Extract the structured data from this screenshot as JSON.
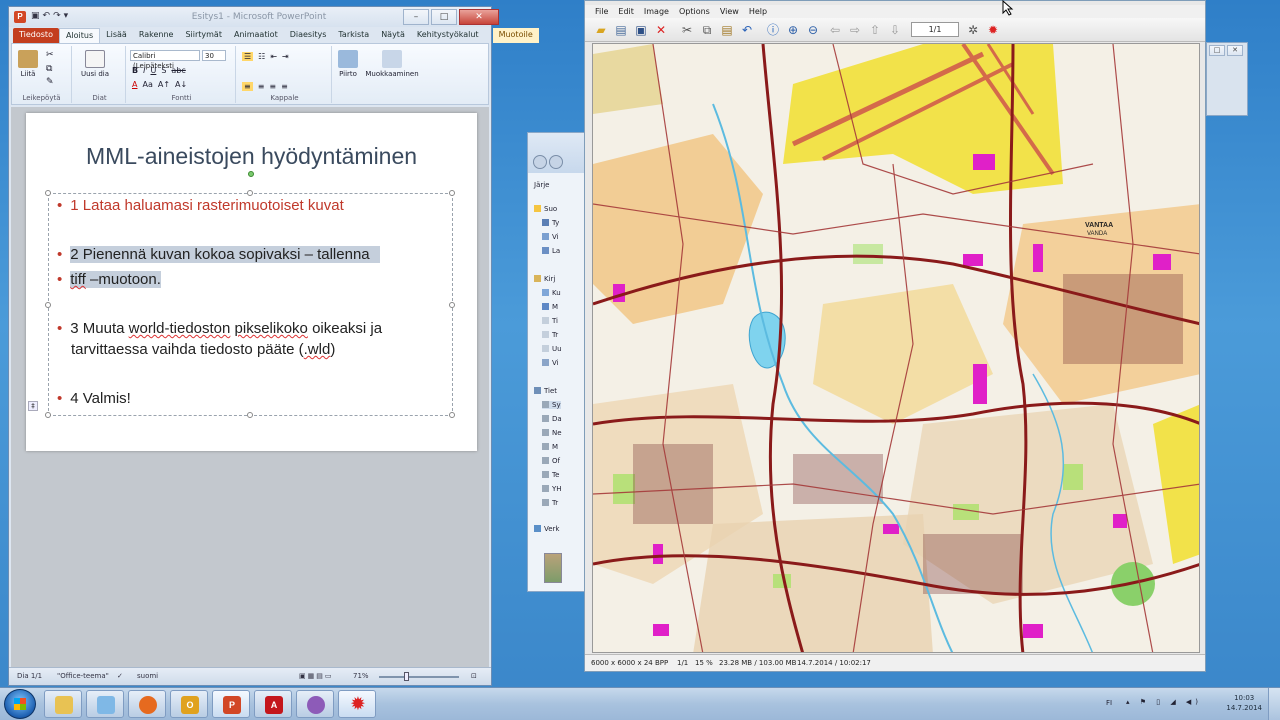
{
  "powerpoint": {
    "window_title": "Esitys1 - Microsoft PowerPoint",
    "app_icon": "P",
    "tabs": [
      "Tiedosto",
      "Aloitus",
      "Lisää",
      "Rakenne",
      "Siirtymät",
      "Animaatiot",
      "Diaesitys",
      "Tarkista",
      "Näytä",
      "Kehitystyökalut",
      "Muotoile"
    ],
    "ribbon": {
      "paste_label": "Liitä",
      "new_slide_label": "Uusi dia",
      "font_name": "Calibri (Leipäteksti",
      "font_size": "30",
      "draw_label": "Piirto",
      "editing_label": "Muokkaaminen",
      "groups": [
        "Leikepöytä",
        "Diat",
        "Fontti",
        "Kappale"
      ]
    },
    "slide": {
      "title": "MML-aineistojen hyödyntäminen",
      "bullets": {
        "b1": "1 Lataa haluamasi rasterimuotoiset  kuvat",
        "b2": "2 Pienennä kuvan kokoa sopivaksi – tallenna",
        "b3a": "tiff",
        "b3b": " –muotoon.",
        "b4a": "3 Muuta ",
        "b4b": "world-tiedoston",
        "b4c": " ",
        "b4d": "pikselikoko",
        "b4e": " oikeaksi ja",
        "b5a": "tarvittaessa vaihda tiedosto pääte (",
        "b5b": ".wld",
        "b5c": ")",
        "b6": "4 Valmis!"
      }
    },
    "status": {
      "slide": "Dia 1/1",
      "theme": "\"Office-teema\"",
      "language": "suomi",
      "zoom": "71%"
    }
  },
  "explorer": {
    "toolbar_label": "Järje",
    "items": [
      "Suo",
      "Ty",
      "Vi",
      "La",
      "Kirj",
      "Ku",
      "M",
      "Ti",
      "Tr",
      "Uu",
      "Vi",
      "Tiet",
      "Sy",
      "Da",
      "Ne",
      "M",
      "Of",
      "Te",
      "YH",
      "Tr",
      "Verk"
    ]
  },
  "irfanview": {
    "menu": [
      "File",
      "Edit",
      "Image",
      "Options",
      "View",
      "Help"
    ],
    "page_box": "1/1",
    "status": {
      "dims": "6000 x 6000 x 24 BPP",
      "page": "1/1",
      "zoom": "15 %",
      "memory": "23.28 MB / 103.00 MB",
      "datetime": "14.7.2014 / 10:02:17"
    },
    "map_labels": {
      "city": "VANTAA",
      "city_sv": "VANDA"
    }
  },
  "taskbar": {
    "lang": "FI",
    "time": "10:03",
    "date": "14.7.2014"
  },
  "colors": {
    "ppt_red": "#c33e1f",
    "bullet_red": "#c0392b",
    "title_gray": "#3a4a5e",
    "map_yellow": "#f2e24a",
    "map_orange": "#f2b24a",
    "map_magenta": "#e020c8",
    "map_green": "#b8e07a",
    "map_road": "#8a1a1a",
    "lake_blue": "#7fd3ee"
  }
}
